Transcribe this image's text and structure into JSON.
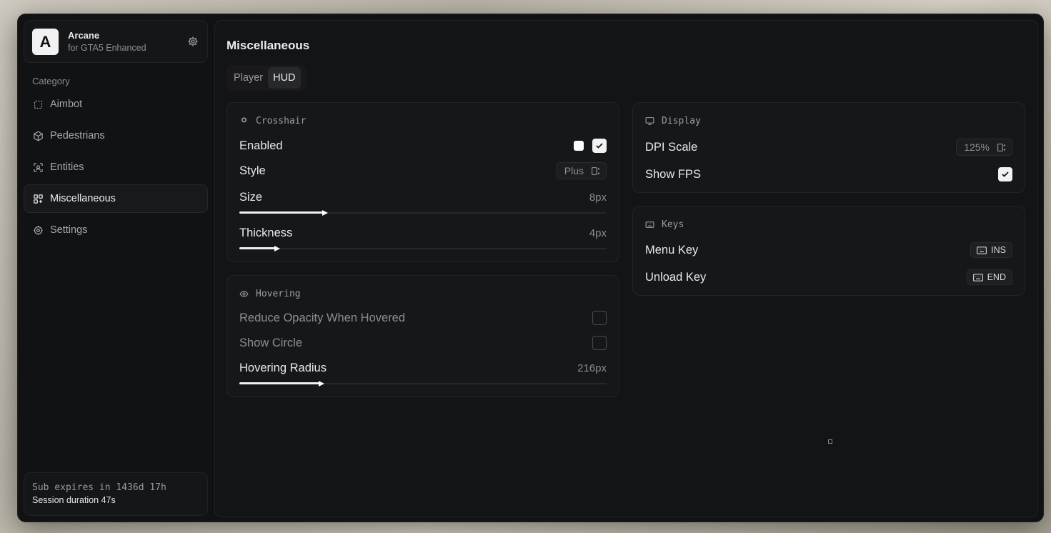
{
  "brand": {
    "logo_letter": "A",
    "name": "Arcane",
    "subtitle": "for GTA5 Enhanced"
  },
  "sidebar": {
    "category_label": "Category",
    "items": [
      {
        "label": "Aimbot",
        "icon": "dashed-square-icon",
        "active": false
      },
      {
        "label": "Pedestrians",
        "icon": "cube-icon",
        "active": false
      },
      {
        "label": "Entities",
        "icon": "scan-face-icon",
        "active": false
      },
      {
        "label": "Miscellaneous",
        "icon": "blocks-icon",
        "active": true
      },
      {
        "label": "Settings",
        "icon": "gear-icon",
        "active": false
      }
    ],
    "subscription": {
      "expires": "Sub expires in 1436d 17h",
      "session": "Session duration 47s"
    }
  },
  "main": {
    "title": "Miscellaneous",
    "tabs": [
      {
        "label": "Player",
        "active": false
      },
      {
        "label": "HUD",
        "active": true
      }
    ],
    "crosshair": {
      "title": "Crosshair",
      "enabled_label": "Enabled",
      "enabled": true,
      "color": "#ffffff",
      "style_label": "Style",
      "style_value": "Plus",
      "size_label": "Size",
      "size_value": "8px",
      "size_fraction": 0.23,
      "thickness_label": "Thickness",
      "thickness_value": "4px",
      "thickness_fraction": 0.1
    },
    "hovering": {
      "title": "Hovering",
      "reduce_opacity_label": "Reduce Opacity When Hovered",
      "reduce_opacity": false,
      "show_circle_label": "Show Circle",
      "show_circle": false,
      "radius_label": "Hovering Radius",
      "radius_value": "216px",
      "radius_fraction": 0.22
    },
    "display": {
      "title": "Display",
      "dpi_label": "DPI Scale",
      "dpi_value": "125%",
      "fps_label": "Show FPS",
      "fps": true
    },
    "keys": {
      "title": "Keys",
      "menu_label": "Menu Key",
      "menu_value": "INS",
      "unload_label": "Unload Key",
      "unload_value": "END"
    }
  }
}
